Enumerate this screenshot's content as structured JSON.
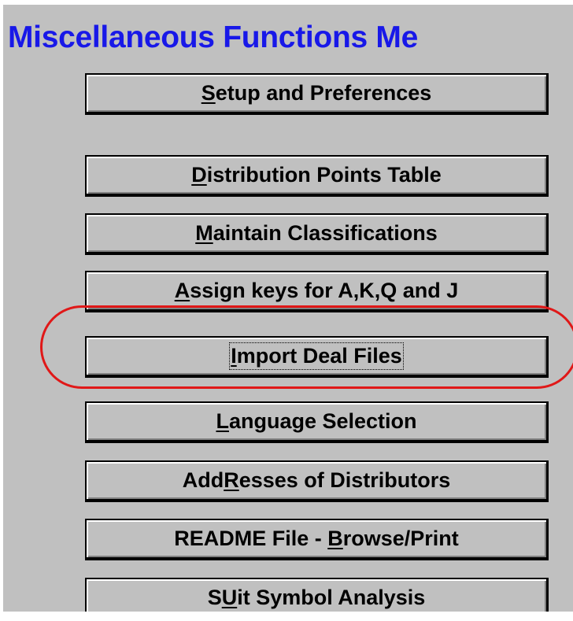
{
  "title": "Miscellaneous Functions Me",
  "accent_colors": {
    "title": "#1818e8",
    "highlight": "#e01818",
    "face": "#c0c0c0"
  },
  "buttons": [
    {
      "pre": "",
      "key": "S",
      "post": "etup and Preferences"
    },
    {
      "pre": "",
      "key": "D",
      "post": "istribution Points Table"
    },
    {
      "pre": "",
      "key": "M",
      "post": "aintain Classifications"
    },
    {
      "pre": "",
      "key": "A",
      "post": "ssign keys for A,K,Q and J"
    },
    {
      "pre": "",
      "key": "I",
      "post": "mport Deal Files"
    },
    {
      "pre": "",
      "key": "L",
      "post": "anguage Selection"
    },
    {
      "pre": "Add",
      "key": "R",
      "post": "esses of Distributors"
    },
    {
      "pre": "README File - ",
      "key": "B",
      "post": "rowse/Print"
    },
    {
      "pre": "S",
      "key": "U",
      "post": "it Symbol Analysis"
    }
  ]
}
